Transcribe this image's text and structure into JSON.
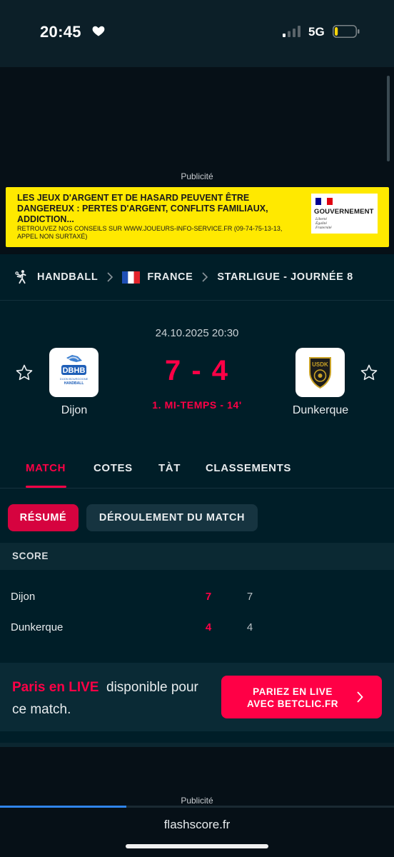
{
  "status_bar": {
    "time": "20:45",
    "network": "5G",
    "battery_level": 0.15
  },
  "ad_top": {
    "label": "Publicité",
    "warning": "LES JEUX D'ARGENT ET DE HASARD PEUVENT ÊTRE DANGEREUX : PERTES D'ARGENT, CONFLITS FAMILIAUX, ADDICTION...",
    "advice": "RETROUVEZ NOS CONSEILS SUR WWW.JOUEURS-INFO-SERVICE.FR (09-74-75-13-13, APPEL NON SURTAXÉ)",
    "gov_title": "GOUVERNEMENT",
    "gov_motto": [
      "Liberté",
      "Égalité",
      "Fraternité"
    ]
  },
  "breadcrumb": {
    "sport": "HANDBALL",
    "country": "FRANCE",
    "league": "STARLIGUE - JOURNÉE 8"
  },
  "match": {
    "datetime": "24.10.2025 20:30",
    "home": {
      "name": "Dijon",
      "logo_text": "DBHB",
      "logo_sub": "HANDBALL"
    },
    "away": {
      "name": "Dunkerque",
      "logo_text": "USDK"
    },
    "score": "7 - 4",
    "status": "1. MI-TEMPS - 14'"
  },
  "tabs": [
    "MATCH",
    "COTES",
    "TÀT",
    "CLASSEMENTS"
  ],
  "active_tab": 0,
  "subtabs": [
    "RÉSUMÉ",
    "DÉROULEMENT DU MATCH"
  ],
  "score_section": {
    "title": "SCORE",
    "rows": [
      {
        "team": "Dijon",
        "total": "7",
        "period1": "7"
      },
      {
        "team": "Dunkerque",
        "total": "4",
        "period1": "4"
      }
    ]
  },
  "live": {
    "highlight": "Paris en LIVE",
    "text": "disponible pour ce match.",
    "button_line1": "PARIEZ EN LIVE",
    "button_line2": "AVEC BETCLIC.FR"
  },
  "ad_bottom": {
    "label": "Publicité",
    "url": "flashscore.fr",
    "load_progress": 0.32
  },
  "colors": {
    "accent": "#ff0046",
    "background": "#001e28",
    "ad_yellow": "#ffe900",
    "progress": "#2f84ea"
  }
}
